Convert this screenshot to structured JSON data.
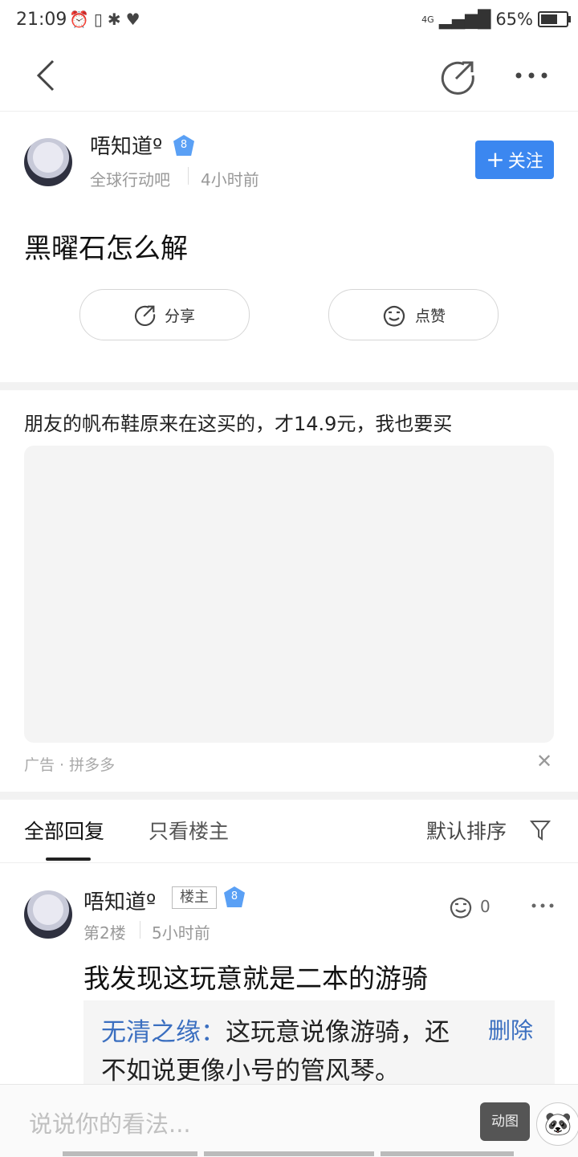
{
  "status_bar": {
    "time": "21:09",
    "network": "4G",
    "battery": "65%",
    "battery_level": 0.65
  },
  "post": {
    "author": "唔知道º",
    "level": "8",
    "forum": "全球行动吧",
    "time_ago": "4小时前",
    "follow_label": "关注",
    "title": "黑曜石怎么解",
    "share_label": "分享",
    "like_label": "点赞"
  },
  "ad": {
    "title": "朋友的帆布鞋原来在这买的，才14.9元，我也要买",
    "label": "广告 · 拼多多"
  },
  "tabs": {
    "all": "全部回复",
    "owner_only": "只看楼主",
    "sort": "默认排序"
  },
  "reply": {
    "author": "唔知道º",
    "owner_tag": "楼主",
    "level": "8",
    "floor": "第2楼",
    "time_ago": "5小时前",
    "like_count": "0",
    "content": "我发现这玩意就是二本的游骑",
    "sub_reply": {
      "author": "无清之缘：",
      "text": "这玩意说像游骑，还不如说更像小号的管风琴。",
      "delete_label": "删除"
    }
  },
  "input": {
    "placeholder": "说说你的看法...",
    "gif_label": "动图"
  },
  "icons": {
    "back": "chevron-left-icon",
    "share": "share-arrow-icon",
    "more": "more-dots-icon",
    "like": "like-face-icon",
    "filter": "filter-funnel-icon",
    "close": "close-icon"
  }
}
